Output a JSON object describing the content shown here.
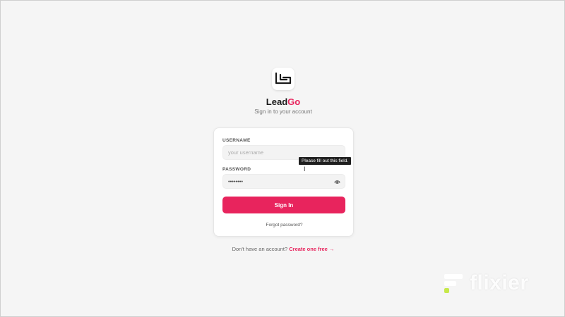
{
  "brand": {
    "name_part1": "Lead",
    "name_part2": "Go",
    "logo": "leadgo-logo-icon"
  },
  "subtitle": "Sign in to your account",
  "form": {
    "username_label": "USERNAME",
    "username_placeholder": "your username",
    "password_label": "PASSWORD",
    "password_value": "••••••••",
    "signin_label": "Sign In",
    "forgot_label": "Forgot password?",
    "tooltip": "Please fill out this field."
  },
  "footer": {
    "text": "Don't have an account?",
    "link": "Create one free →"
  },
  "watermark": {
    "text": "flixier"
  },
  "colors": {
    "accent": "#e8245d",
    "background": "#f5f5f5",
    "card": "#ffffff"
  }
}
